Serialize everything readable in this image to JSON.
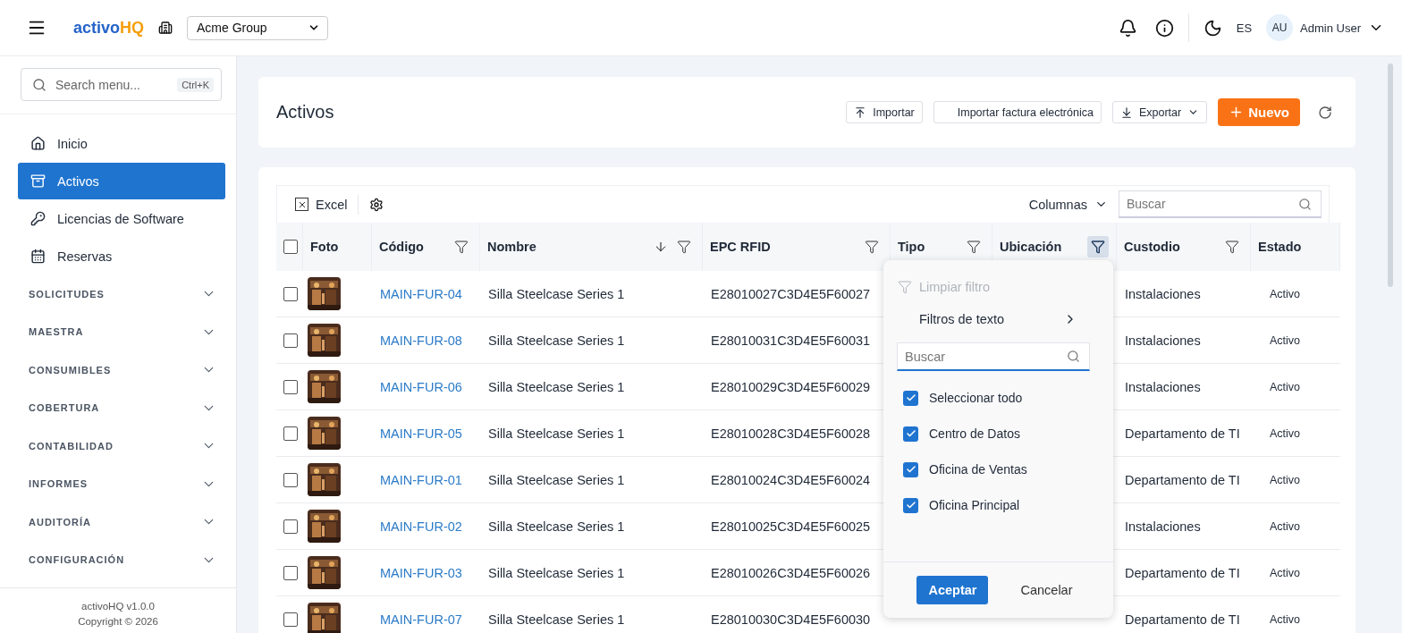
{
  "topbar": {
    "brand_main": "activo",
    "brand_accent": "HQ",
    "organization": "Acme Group",
    "language": "ES",
    "avatar": "AU",
    "user": "Admin User"
  },
  "sidebar": {
    "search_placeholder": "Search menu...",
    "shortcut": "Ctrl+K",
    "items": [
      {
        "label": "Inicio",
        "selected": false
      },
      {
        "label": "Activos",
        "selected": true
      },
      {
        "label": "Licencias de Software",
        "selected": false
      },
      {
        "label": "Reservas",
        "selected": false
      }
    ],
    "sections": [
      {
        "label": "SOLICITUDES",
        "expanded": false
      },
      {
        "label": "MAESTRA",
        "expanded": false
      },
      {
        "label": "CONSUMIBLES",
        "expanded": false
      },
      {
        "label": "COBERTURA",
        "expanded": false
      },
      {
        "label": "CONTABILIDAD",
        "expanded": false
      },
      {
        "label": "INFORMES",
        "expanded": false
      },
      {
        "label": "AUDITORÍA",
        "expanded": false
      },
      {
        "label": "CONFIGURACIÓN",
        "expanded": false
      }
    ],
    "version": "activoHQ v1.0.0",
    "copyright": "Copyright © 2026"
  },
  "page": {
    "title": "Activos",
    "actions": [
      {
        "label": "Importar",
        "kind": "upload"
      },
      {
        "label": "Importar factura electrónica",
        "kind": "plain"
      },
      {
        "label": "Exportar",
        "kind": "download"
      },
      {
        "label": "Nuevo",
        "kind": "primary"
      }
    ]
  },
  "table": {
    "all_selected": false,
    "excel": "Excel",
    "columns_button": "Columnas",
    "search_placeholder": "Buscar",
    "columns": [
      {
        "label": "Foto",
        "filter": false,
        "sorted": false
      },
      {
        "label": "Código",
        "filter": true,
        "sorted": false,
        "filter_open": false
      },
      {
        "label": "Nombre",
        "filter": true,
        "sorted": true,
        "filter_open": false
      },
      {
        "label": "EPC RFID",
        "filter": true,
        "sorted": false,
        "filter_open": false
      },
      {
        "label": "Tipo",
        "filter": true,
        "sorted": false,
        "filter_open": false
      },
      {
        "label": "Ubicación",
        "filter": true,
        "sorted": false,
        "filter_open": true
      },
      {
        "label": "Custodio",
        "filter": true,
        "sorted": false,
        "filter_open": false
      },
      {
        "label": "Estado",
        "filter": false,
        "sorted": false
      }
    ],
    "rows": [
      {
        "selected": false,
        "code": "MAIN-FUR-04",
        "name": "Silla Steelcase Series 1",
        "epc": "E28010027C3D4E5F60027",
        "custodian": "Instalaciones",
        "status": "Activo"
      },
      {
        "selected": false,
        "code": "MAIN-FUR-08",
        "name": "Silla Steelcase Series 1",
        "epc": "E28010031C3D4E5F60031",
        "custodian": "Instalaciones",
        "status": "Activo"
      },
      {
        "selected": false,
        "code": "MAIN-FUR-06",
        "name": "Silla Steelcase Series 1",
        "epc": "E28010029C3D4E5F60029",
        "custodian": "Instalaciones",
        "status": "Activo"
      },
      {
        "selected": false,
        "code": "MAIN-FUR-05",
        "name": "Silla Steelcase Series 1",
        "epc": "E28010028C3D4E5F60028",
        "custodian": "Departamento de TI",
        "status": "Activo"
      },
      {
        "selected": false,
        "code": "MAIN-FUR-01",
        "name": "Silla Steelcase Series 1",
        "epc": "E28010024C3D4E5F60024",
        "custodian": "Departamento de TI",
        "status": "Activo"
      },
      {
        "selected": false,
        "code": "MAIN-FUR-02",
        "name": "Silla Steelcase Series 1",
        "epc": "E28010025C3D4E5F60025",
        "custodian": "Instalaciones",
        "status": "Activo"
      },
      {
        "selected": false,
        "code": "MAIN-FUR-03",
        "name": "Silla Steelcase Series 1",
        "epc": "E28010026C3D4E5F60026",
        "custodian": "Departamento de TI",
        "status": "Activo"
      },
      {
        "selected": false,
        "code": "MAIN-FUR-07",
        "name": "Silla Steelcase Series 1",
        "epc": "E28010030C3D4E5F60030",
        "custodian": "Departamento de TI",
        "status": "Activo"
      }
    ]
  },
  "filter_menu": {
    "clear": {
      "label": "Limpiar filtro",
      "disabled": true
    },
    "text_filters": "Filtros de texto",
    "search_placeholder": "Buscar",
    "options": [
      {
        "label": "Seleccionar todo",
        "checked": true
      },
      {
        "label": "Centro de Datos",
        "checked": true
      },
      {
        "label": "Oficina de Ventas",
        "checked": true
      },
      {
        "label": "Oficina Principal",
        "checked": true
      }
    ],
    "accept": "Aceptar",
    "cancel": "Cancelar"
  }
}
